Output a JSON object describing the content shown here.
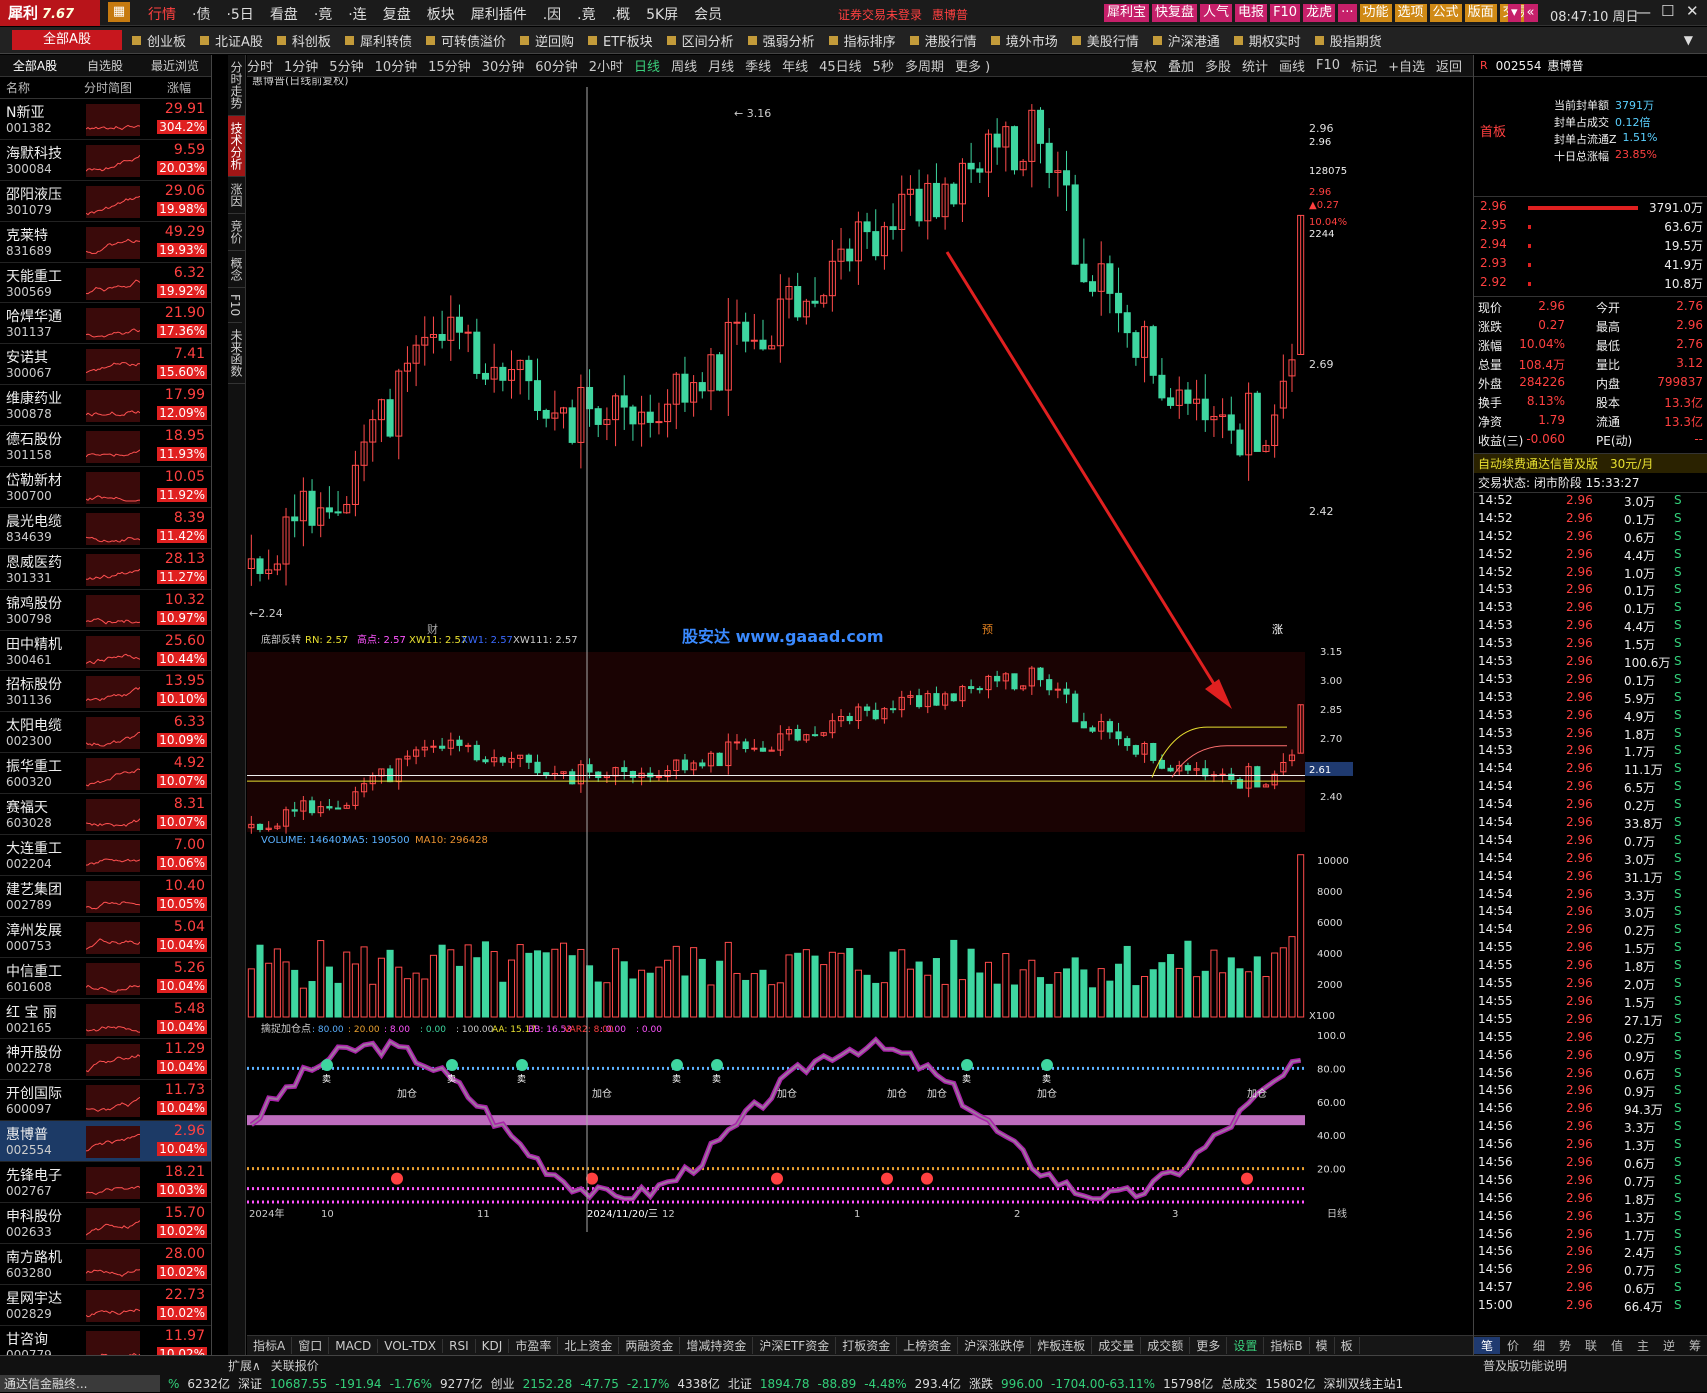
{
  "app": {
    "logo_text": "犀利",
    "version": "7.67",
    "notice": "证券交易未登录",
    "stock_name_top": "惠博普",
    "clock": "08:47:10 周日"
  },
  "menu": [
    "行情",
    "·债",
    "·5日",
    "看盘",
    "·竟",
    "·连",
    "复盘",
    "板块",
    "犀利插件",
    ".因",
    ".竟",
    ".概",
    "5K屏",
    "会员"
  ],
  "top_buttons": [
    "犀利宝",
    "快复盘",
    "人气",
    "电报",
    "F10",
    "龙虎",
    "···",
    "功能",
    "选项",
    "公式",
    "版面",
    "交易"
  ],
  "tabs": [
    "全部A股",
    "创业板",
    "北证A股",
    "科创板",
    "犀利转债",
    "可转债溢价",
    "逆回购",
    "ETF板块",
    "区间分析",
    "强弱分析",
    "指标排序",
    "港股行情",
    "境外市场",
    "美股行情",
    "沪深港通",
    "期权实时",
    "股指期货"
  ],
  "left": {
    "tabs": [
      "全部A股",
      "自选股",
      "最近浏览"
    ],
    "headers": [
      "名称",
      "分时简图",
      "涨幅"
    ],
    "stocks": [
      {
        "name": "N新亚",
        "code": "001382",
        "price": "29.91",
        "pct": "304.2%"
      },
      {
        "name": "海默科技",
        "code": "300084",
        "price": "9.59",
        "pct": "20.03%"
      },
      {
        "name": "邵阳液压",
        "code": "301079",
        "price": "29.06",
        "pct": "19.98%"
      },
      {
        "name": "克莱特",
        "code": "831689",
        "price": "49.29",
        "pct": "19.93%"
      },
      {
        "name": "天能重工",
        "code": "300569",
        "price": "6.32",
        "pct": "19.92%"
      },
      {
        "name": "哈焊华通",
        "code": "301137",
        "price": "21.90",
        "pct": "17.36%"
      },
      {
        "name": "安诺其",
        "code": "300067",
        "price": "7.41",
        "pct": "15.60%"
      },
      {
        "name": "维康药业",
        "code": "300878",
        "price": "17.99",
        "pct": "12.09%"
      },
      {
        "name": "德石股份",
        "code": "301158",
        "price": "18.95",
        "pct": "11.93%"
      },
      {
        "name": "岱勒新材",
        "code": "300700",
        "price": "10.05",
        "pct": "11.92%"
      },
      {
        "name": "晨光电缆",
        "code": "834639",
        "price": "8.39",
        "pct": "11.42%"
      },
      {
        "name": "恩威医药",
        "code": "301331",
        "price": "28.13",
        "pct": "11.27%"
      },
      {
        "name": "锦鸡股份",
        "code": "300798",
        "price": "10.32",
        "pct": "10.97%"
      },
      {
        "name": "田中精机",
        "code": "300461",
        "price": "25.60",
        "pct": "10.44%"
      },
      {
        "name": "招标股份",
        "code": "301136",
        "price": "13.95",
        "pct": "10.10%"
      },
      {
        "name": "太阳电缆",
        "code": "002300",
        "price": "6.33",
        "pct": "10.09%"
      },
      {
        "name": "振华重工",
        "code": "600320",
        "price": "4.92",
        "pct": "10.07%"
      },
      {
        "name": "赛福天",
        "code": "603028",
        "price": "8.31",
        "pct": "10.07%"
      },
      {
        "name": "大连重工",
        "code": "002204",
        "price": "7.00",
        "pct": "10.06%"
      },
      {
        "name": "建艺集团",
        "code": "002789",
        "price": "10.40",
        "pct": "10.05%"
      },
      {
        "name": "漳州发展",
        "code": "000753",
        "price": "5.04",
        "pct": "10.04%"
      },
      {
        "name": "中信重工",
        "code": "601608",
        "price": "5.26",
        "pct": "10.04%"
      },
      {
        "name": "红 宝 丽",
        "code": "002165",
        "price": "5.48",
        "pct": "10.04%"
      },
      {
        "name": "神开股份",
        "code": "002278",
        "price": "11.29",
        "pct": "10.04%"
      },
      {
        "name": "开创国际",
        "code": "600097",
        "price": "11.73",
        "pct": "10.04%"
      },
      {
        "name": "惠博普",
        "code": "002554",
        "price": "2.96",
        "pct": "10.04%"
      },
      {
        "name": "先锋电子",
        "code": "002767",
        "price": "18.21",
        "pct": "10.03%"
      },
      {
        "name": "申科股份",
        "code": "002633",
        "price": "15.70",
        "pct": "10.02%"
      },
      {
        "name": "南方路机",
        "code": "603280",
        "price": "28.00",
        "pct": "10.02%"
      },
      {
        "name": "星网宇达",
        "code": "002829",
        "price": "22.73",
        "pct": "10.02%"
      },
      {
        "name": "甘咨询",
        "code": "000779",
        "price": "11.97",
        "pct": "10.02%"
      }
    ]
  },
  "vside": [
    "分时走势",
    "技术分析",
    "涨因",
    "竞价",
    "概念",
    "F10",
    "未来函数"
  ],
  "chart_toolbar": {
    "periods": [
      "分时",
      "1分钟",
      "5分钟",
      "10分钟",
      "15分钟",
      "30分钟",
      "60分钟",
      "2小时",
      "日线",
      "周线",
      "月线",
      "季线",
      "年线",
      "45日线",
      "5秒",
      "多周期",
      "更多 )"
    ],
    "active": "日线",
    "right": [
      "复权",
      "叠加",
      "多股",
      "统计",
      "画线",
      "F10",
      "标记",
      "+自选",
      "返回"
    ]
  },
  "chart_data": [
    {
      "type": "candlestick",
      "title": "惠博普(日线前复权)",
      "y_ticks": [
        "2.96",
        "2.69",
        "2.42"
      ],
      "labels": {
        "high": "3.16",
        "low": "2.24"
      },
      "right_info": [
        "2.96",
        "128075",
        "2.96",
        "▲0.27",
        "10.04%",
        "2244"
      ],
      "markers": [
        "财",
        "预",
        "涨"
      ]
    },
    {
      "type": "indicator",
      "title": "底部反转",
      "legend": [
        "RN: 2.57",
        "高点: 2.57",
        "XW11: 2.57",
        "XW1: 2.57",
        "XW111: 2.57"
      ],
      "y_ticks": [
        "3.15",
        "3.00",
        "2.85",
        "2.70",
        "2.55",
        "2.40"
      ],
      "current": "2.61"
    },
    {
      "type": "bar",
      "title": "VOLUME",
      "legend": [
        "VOLUME: 146401",
        "MA5: 190500",
        "MA10: 296428"
      ],
      "y_ticks": [
        "10000",
        "8000",
        "6000",
        "4000",
        "2000"
      ],
      "unit": "X100"
    },
    {
      "type": "line",
      "title": "擒捉加仓点",
      "legend": [
        ": 80.00",
        ": 20.00",
        ": 8.00",
        ": 0.00",
        ": 100.00",
        "AA: 15.17",
        "BB: 16.53",
        "VAR2: 8.00",
        ": 0.00",
        ": 0.00"
      ],
      "y_ticks": [
        "100.0",
        "80.00",
        "60.00",
        "40.00",
        "20.00"
      ],
      "x_labels": [
        "2024年",
        "10",
        "11",
        "2024/11/20/三",
        "12",
        "1",
        "2",
        "3"
      ],
      "signals": [
        "加仓",
        "卖"
      ]
    }
  ],
  "watermark": "股安达 www.gaaad.com",
  "right": {
    "code": "002554",
    "name": "惠博普",
    "board": "首板",
    "seal": [
      [
        "当前封单额",
        "3791万"
      ],
      [
        "封单占成交",
        "0.12倍"
      ],
      [
        "封单占流通Z",
        "1.51%"
      ],
      [
        "十日总涨幅",
        "23.85%"
      ]
    ],
    "asks": [
      [
        "2.96",
        "3791.0万"
      ],
      [
        "2.95",
        "63.6万"
      ],
      [
        "2.94",
        "19.5万"
      ],
      [
        "2.93",
        "41.9万"
      ],
      [
        "2.92",
        "10.8万"
      ]
    ],
    "quote": [
      [
        "现价",
        "2.96",
        "今开",
        "2.76"
      ],
      [
        "涨跌",
        "0.27",
        "最高",
        "2.96"
      ],
      [
        "涨幅",
        "10.04%",
        "最低",
        "2.76"
      ],
      [
        "总量",
        "108.4万",
        "量比",
        "3.12"
      ],
      [
        "外盘",
        "284226",
        "内盘",
        "799837"
      ],
      [
        "换手",
        "8.13%",
        "股本",
        "13.3亿"
      ],
      [
        "净资",
        "1.79",
        "流通",
        "13.3亿"
      ],
      [
        "收益(三)",
        "-0.060",
        "PE(动)",
        "--"
      ]
    ],
    "promo": [
      "自动续费通达信普及版",
      "30元/月"
    ],
    "status": "交易状态: 闭市阶段 15:33:27",
    "ticks": [
      [
        "14:52",
        "2.96",
        "3.0万",
        "S"
      ],
      [
        "14:52",
        "2.96",
        "0.1万",
        "S"
      ],
      [
        "14:52",
        "2.96",
        "0.6万",
        "S"
      ],
      [
        "14:52",
        "2.96",
        "4.4万",
        "S"
      ],
      [
        "14:52",
        "2.96",
        "1.0万",
        "S"
      ],
      [
        "14:53",
        "2.96",
        "0.1万",
        "S"
      ],
      [
        "14:53",
        "2.96",
        "0.1万",
        "S"
      ],
      [
        "14:53",
        "2.96",
        "4.4万",
        "S"
      ],
      [
        "14:53",
        "2.96",
        "1.5万",
        "S"
      ],
      [
        "14:53",
        "2.96",
        "100.6万",
        "S"
      ],
      [
        "14:53",
        "2.96",
        "0.1万",
        "S"
      ],
      [
        "14:53",
        "2.96",
        "5.9万",
        "S"
      ],
      [
        "14:53",
        "2.96",
        "4.9万",
        "S"
      ],
      [
        "14:53",
        "2.96",
        "1.8万",
        "S"
      ],
      [
        "14:53",
        "2.96",
        "1.7万",
        "S"
      ],
      [
        "14:54",
        "2.96",
        "11.1万",
        "S"
      ],
      [
        "14:54",
        "2.96",
        "6.5万",
        "S"
      ],
      [
        "14:54",
        "2.96",
        "0.2万",
        "S"
      ],
      [
        "14:54",
        "2.96",
        "33.8万",
        "S"
      ],
      [
        "14:54",
        "2.96",
        "0.7万",
        "S"
      ],
      [
        "14:54",
        "2.96",
        "3.0万",
        "S"
      ],
      [
        "14:54",
        "2.96",
        "31.1万",
        "S"
      ],
      [
        "14:54",
        "2.96",
        "3.3万",
        "S"
      ],
      [
        "14:54",
        "2.96",
        "3.0万",
        "S"
      ],
      [
        "14:54",
        "2.96",
        "0.2万",
        "S"
      ],
      [
        "14:55",
        "2.96",
        "1.5万",
        "S"
      ],
      [
        "14:55",
        "2.96",
        "1.8万",
        "S"
      ],
      [
        "14:55",
        "2.96",
        "2.0万",
        "S"
      ],
      [
        "14:55",
        "2.96",
        "1.5万",
        "S"
      ],
      [
        "14:55",
        "2.96",
        "27.1万",
        "S"
      ],
      [
        "14:55",
        "2.96",
        "0.2万",
        "S"
      ],
      [
        "14:56",
        "2.96",
        "0.9万",
        "S"
      ],
      [
        "14:56",
        "2.96",
        "0.6万",
        "S"
      ],
      [
        "14:56",
        "2.96",
        "0.9万",
        "S"
      ],
      [
        "14:56",
        "2.96",
        "94.3万",
        "S"
      ],
      [
        "14:56",
        "2.96",
        "3.3万",
        "S"
      ],
      [
        "14:56",
        "2.96",
        "1.3万",
        "S"
      ],
      [
        "14:56",
        "2.96",
        "0.6万",
        "S"
      ],
      [
        "14:56",
        "2.96",
        "0.7万",
        "S"
      ],
      [
        "14:56",
        "2.96",
        "1.8万",
        "S"
      ],
      [
        "14:56",
        "2.96",
        "1.3万",
        "S"
      ],
      [
        "14:56",
        "2.96",
        "1.7万",
        "S"
      ],
      [
        "14:56",
        "2.96",
        "2.4万",
        "S"
      ],
      [
        "14:56",
        "2.96",
        "0.7万",
        "S"
      ],
      [
        "14:57",
        "2.96",
        "0.6万",
        "S"
      ],
      [
        "15:00",
        "2.96",
        "66.4万",
        "S"
      ]
    ],
    "bottom_tabs": [
      "笔",
      "价",
      "细",
      "势",
      "联",
      "值",
      "主",
      "逆",
      "筹"
    ]
  },
  "bottom_tabs": [
    "指标A",
    "窗口",
    "MACD",
    "VOL-TDX",
    "RSI",
    "KDJ",
    "市盈率",
    "北上资金",
    "两融资金",
    "增减持资金",
    "沪深ETF资金",
    "打板资金",
    "上榜资金",
    "沪深涨跌停",
    "炸板连板",
    "成交量",
    "成交额",
    "更多",
    "设置",
    "指标B",
    "模",
    "板"
  ],
  "status": [
    "扩展∧",
    "关联报价",
    "%",
    "6232亿",
    "深证",
    "10687.55",
    "-191.94",
    "-1.76%",
    "9277亿",
    "创业",
    "2152.28",
    "-47.75",
    "-2.17%",
    "4338亿",
    "北证",
    "1894.78",
    "-88.89",
    "-4.48%",
    "293.4亿",
    "涨跌",
    "996.00",
    "-1704.00-63.11%",
    "15798亿",
    "总成交",
    "15802亿",
    "深圳双线主站1",
    "通达信金融终...",
    "普及版功能说明"
  ]
}
